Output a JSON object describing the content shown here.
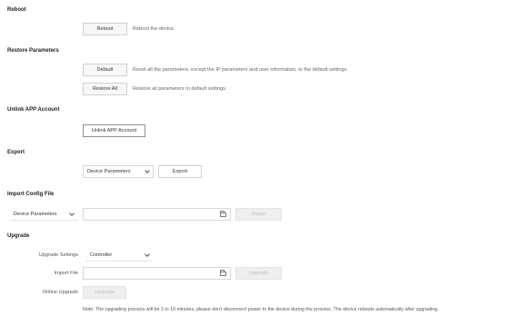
{
  "reboot": {
    "title": "Reboot",
    "button": "Reboot",
    "description": "Reboot the device."
  },
  "restore": {
    "title": "Restore Parameters",
    "default_button": "Default",
    "default_description": "Reset all the parameters, except the IP parameters and user information, to the default settings.",
    "restore_all_button": "Restore All",
    "restore_all_description": "Restore all parameters to default settings."
  },
  "unlink": {
    "title": "Unlink APP Account",
    "button": "Unlink APP Account"
  },
  "export": {
    "title": "Export",
    "select_value": "Device Parameters",
    "button": "Export"
  },
  "import_config": {
    "title": "Import Config File",
    "select_value": "Device Parameters",
    "button": "Import"
  },
  "upgrade": {
    "title": "Upgrade",
    "settings_label": "Upgrade Settings",
    "settings_value": "Controller",
    "import_file_label": "Import File",
    "import_button": "Upgrade",
    "online_label": "Online Upgrade",
    "online_button": "Upgrade",
    "note": "Note: The upgrading process will be 1 to 10 minutes, please don't disconnect power to the device during the process. The device reboots automatically after upgrading."
  }
}
